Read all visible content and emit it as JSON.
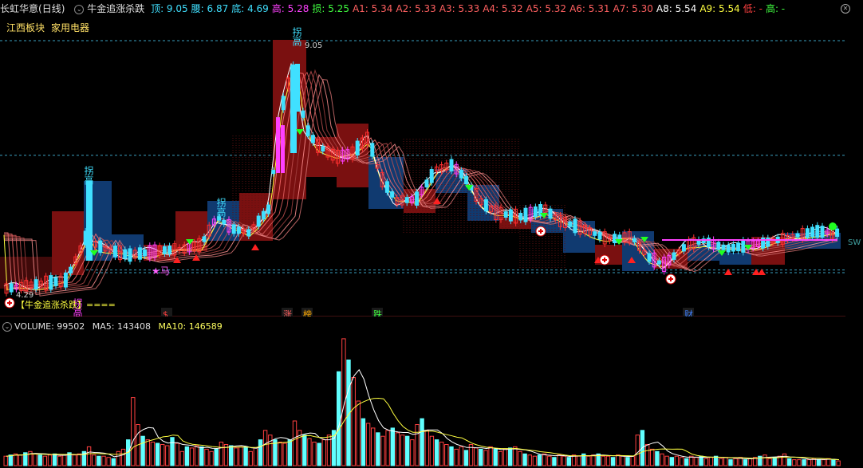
{
  "header": {
    "stock_name": "长虹华意",
    "period": "(日线)",
    "indicator_name": "牛金追涨杀跌",
    "items": [
      {
        "label": "顶:",
        "value": "9.05",
        "color": "#40e0ff"
      },
      {
        "label": "腰:",
        "value": "6.87",
        "color": "#40e0ff"
      },
      {
        "label": "底:",
        "value": "4.69",
        "color": "#40e0ff"
      },
      {
        "label": "高:",
        "value": "5.28",
        "color": "#ff40ff"
      },
      {
        "label": "损:",
        "value": "5.25",
        "color": "#40ff40"
      },
      {
        "label": "A1:",
        "value": "5.34",
        "color": "#ff6060"
      },
      {
        "label": "A2:",
        "value": "5.33",
        "color": "#ff6060"
      },
      {
        "label": "A3:",
        "value": "5.33",
        "color": "#ff6060"
      },
      {
        "label": "A4:",
        "value": "5.32",
        "color": "#ff6060"
      },
      {
        "label": "A5:",
        "value": "5.32",
        "color": "#ff6060"
      },
      {
        "label": "A6:",
        "value": "5.31",
        "color": "#ff6060"
      },
      {
        "label": "A7:",
        "value": "5.30",
        "color": "#ff6060"
      },
      {
        "label": "A8:",
        "value": "5.54",
        "color": "#ffffff"
      },
      {
        "label": "A9:",
        "value": "5.54",
        "color": "#ffff40"
      },
      {
        "label": "低:",
        "value": "-",
        "color": "#ff4040"
      },
      {
        "label": "高:",
        "value": "-",
        "color": "#40ff40"
      }
    ]
  },
  "sectors": [
    "江西板块",
    "家用电器"
  ],
  "chart_data": [
    {
      "type": "candlestick",
      "price_labels": {
        "high": "9.05",
        "low": "4.29",
        "right_edge": "SW"
      },
      "signals": [
        "拐高",
        "拐高",
        "拐高",
        "拐高",
        "马"
      ],
      "annotation": "【牛金追涨杀跌】====",
      "event_markers": [
        "$",
        "涨",
        "榜",
        "跌",
        "财"
      ],
      "ylim": [
        4.2,
        9.3
      ]
    },
    {
      "type": "bar",
      "title": "VOLUME",
      "volume": "99502",
      "ma5_label": "MA5:",
      "ma5": "143408",
      "ma10_label": "MA10:",
      "ma10": "146589",
      "values": [
        8,
        9,
        10,
        9,
        11,
        12,
        10,
        9,
        8,
        9,
        10,
        8,
        9,
        11,
        9,
        10,
        12,
        16,
        9,
        8,
        8,
        7,
        6,
        12,
        14,
        22,
        58,
        35,
        25,
        22,
        20,
        19,
        18,
        17,
        24,
        19,
        12,
        16,
        15,
        17,
        16,
        14,
        12,
        14,
        20,
        18,
        17,
        15,
        16,
        16,
        12,
        15,
        22,
        30,
        26,
        22,
        20,
        19,
        22,
        38,
        30,
        26,
        23,
        20,
        19,
        22,
        26,
        30,
        80,
        108,
        90,
        75,
        55,
        40,
        36,
        32,
        28,
        25,
        30,
        32,
        28,
        26,
        25,
        22,
        35,
        40,
        30,
        25,
        22,
        20,
        18,
        16,
        14,
        16,
        13,
        18,
        15,
        14,
        13,
        16,
        14,
        12,
        14,
        15,
        16,
        12,
        10,
        9,
        8,
        9,
        10,
        8,
        7,
        9,
        8,
        7,
        9,
        8,
        10,
        8,
        9,
        10,
        8,
        8,
        7,
        9,
        8,
        7,
        8,
        26,
        30,
        18,
        14,
        12,
        10,
        8,
        7,
        8,
        7,
        6,
        8,
        7,
        8,
        6,
        7,
        8,
        6,
        7,
        5,
        6,
        7,
        5,
        6,
        7,
        8,
        9,
        6,
        7,
        8,
        10,
        6,
        5,
        5,
        5,
        5,
        6,
        5,
        5,
        6,
        5,
        4
      ]
    }
  ]
}
